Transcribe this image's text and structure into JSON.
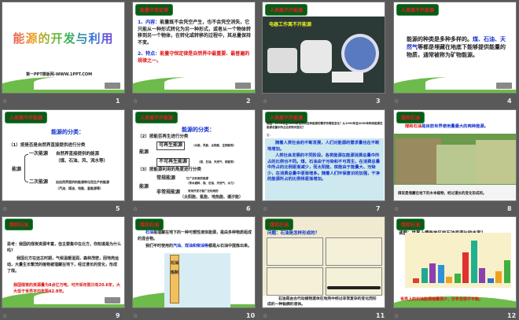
{
  "slides": [
    {
      "num": "1",
      "title": "能源的开发与利用",
      "footer": "第一PPT模板网-WWW.1PPT.COM"
    },
    {
      "num": "2",
      "tag": "能量守恒定律",
      "p1_label": "1、内容：",
      "p1": "能量既不会凭空产生，也不会凭空消失，它只能从一种形式转化为另一种形式，或者从一个物体转移到另一个物体，在转化或转移的过程中，其总量保持不变。",
      "p2_label": "2、特点：",
      "p2": "能量守恒定律是自然界中最重要、最普遍的规律之一。"
    },
    {
      "num": "3",
      "tag": "人类离不开能源",
      "caption": "电器工作离不开能源"
    },
    {
      "num": "4",
      "tag": "人类离不开能源",
      "text_a": "能源的种类是多种多样的。",
      "text_b": "煤、石油、天然气",
      "text_c": "等都是埋藏在地底下能够提供能量的物质，通常被称为矿物能源。"
    },
    {
      "num": "5",
      "tag": "人类离不开能源",
      "heading": "能源的分类：",
      "l1": "（1）按是否是自然界直接提供进行分类",
      "root": "能源",
      "a": "一次能源",
      "a_desc": "自然界直接提供的能源",
      "a_ex": "（煤、石油、风、流水等）",
      "b": "二次能源",
      "b_desc": "由自然界提供的能源转化而生产的能源",
      "b_ex": "（汽油、煤油、电能、氢能源等）"
    },
    {
      "num": "6",
      "tag": "人类离不开能源",
      "heading": "能源的分类：",
      "l2": "（2）按能否再生进行分类",
      "root": "能源",
      "a": "可再生能源",
      "a_ex": "（水能、风能、太阳能、生物能等）",
      "b": "不可再生能源",
      "b_ex": "（煤、石油、天然气、核能等）",
      "l3": "（3）按能源利用的角度进行分类",
      "c": "常规能源",
      "c_desc": "已广泛利用的能源",
      "c_ex": "（草木燃料、煤、石油、天然气、水力）",
      "d": "非常规能源",
      "d_desc": "有待开发才能广泛利用的",
      "d_ex": "（太阳能、氢能、地热能、潮汐能）"
    },
    {
      "num": "7",
      "tag": "人类离不开能源",
      "q": "读图：1990年至2050年世界对各种能源的需求有哪些变化？从1990年至2050年种类能源在能源总量中所占比例有何变化？",
      "ans": "答：",
      "p1": "随着人类社会的不断发展，人们对能源的需求量也在不断地增加。",
      "p2": "人类社会发展的不同阶段，各类能源在能源消费总量中所占的比例也不同。煤、石油由于污染和不可再生，在消费总量中所占的比例逐渐减少，而太阳能、核能由于能量大、污染少，在消费总量中逐渐增多。随着人们环保意识的加强，干净的能源所占的比例将逐渐增加。"
    },
    {
      "num": "8",
      "tag": "煤和石油",
      "head_red": "煤和石油",
      "head_blue": "是目前世界使用量最大的两种能源。",
      "caption": "煤炭是埋藏在地下的木本植物，经过漫长的变化形成的。"
    },
    {
      "num": "9",
      "tag": "煤和石油",
      "q": "思考：我国的煤炭资源丰富，但主要集中在北方，你知道是为什么吗？",
      "a": "我国北方在远古时期，气候温暖湿润，森林茂密，因地壳运动，大量生长繁茂的植物被埋藏在地下，经过漫长的变化，形成了煤。",
      "red": "我国煤炭的资源量为8点亿万吨，可开采年限只有20.6年，大大低于世界平均年限42.8年。"
    },
    {
      "num": "10",
      "tag": "煤和石油",
      "p1_blue": "石油",
      "p1": "是埋藏在地下的一种可燃性液体能源，是由多种物质组成的混合物。",
      "p2a": "我们平时使用的",
      "p2_blue": "汽油、煤油和柴油等",
      "p2b": "都是从石油中提炼出来。",
      "tower": "石油炼制"
    },
    {
      "num": "11",
      "tag": "煤和石油",
      "q": "问题：石油是怎样形成的？",
      "caption": "石油是由古代动植物遗体在地壳中经过非常复杂的变化而形成的一种黏稠的液体。"
    },
    {
      "num": "12",
      "tag": "煤和石油",
      "q": "读图：世界上哪些地区的石油资源比较丰富？",
      "red": "世界上的石油能源储量很少，分布也很不平衡。"
    }
  ],
  "chart_data": {
    "type": "bar",
    "values": [
      3,
      10,
      13,
      12,
      4,
      6,
      20,
      28,
      10,
      3,
      8,
      15
    ],
    "colors": [
      "#e04030",
      "#20a890",
      "#8a40b0",
      "#3090d8",
      "#f0a020",
      "#40b040",
      "#e03030",
      "#20b090",
      "#8a40b0",
      "#3070d0",
      "#f0a020",
      "#40b040"
    ]
  }
}
